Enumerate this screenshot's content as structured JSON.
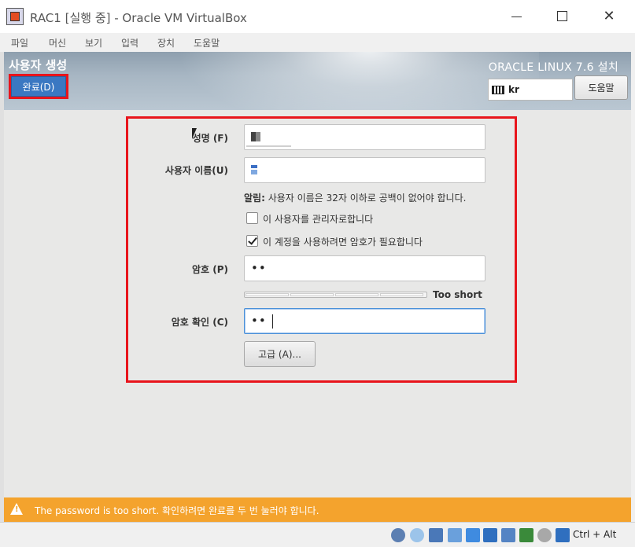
{
  "window": {
    "title": "RAC1 [실행 중] - Oracle VM VirtualBox",
    "icon": "virtualbox-icon",
    "controls": {
      "minimize": "minimize-icon",
      "maximize": "maximize-icon",
      "close": "✕"
    }
  },
  "menubar": {
    "items": [
      "파일",
      "머신",
      "보기",
      "입력",
      "장치",
      "도움말"
    ]
  },
  "header": {
    "page_title": "사용자 생성",
    "done_label": "완료(D)",
    "product_title": "ORACLE LINUX 7.6 설치",
    "keyboard_layout": "kr",
    "help_label": "도움말"
  },
  "form": {
    "fullname_label": "성명 (F)",
    "username_label": "사용자 이름(U)",
    "hint_bold": "알림:",
    "hint_text": " 사용자 이름은 32자 이하로 공백이 없어야 합니다.",
    "admin_checkbox_label": "이 사용자를 관리자로합니다",
    "admin_checked": false,
    "require_password_label": "이 계정을 사용하려면 암호가 필요합니다",
    "require_password_checked": true,
    "password_label": "암호 (P)",
    "password_value": "••",
    "strength_text": "Too short",
    "confirm_label": "암호 확인 (C)",
    "confirm_value": "••",
    "advanced_label": "고급 (A)..."
  },
  "warning": {
    "text": "The password is too short. 확인하려면 완료를 두 번 눌러야 합니다."
  },
  "statusbar": {
    "host_key": "Ctrl + Alt"
  },
  "colors": {
    "highlight_red": "#e8141c",
    "done_blue": "#3a78c2",
    "warning_orange": "#f4a32d",
    "focus_blue": "#4a90d9"
  }
}
